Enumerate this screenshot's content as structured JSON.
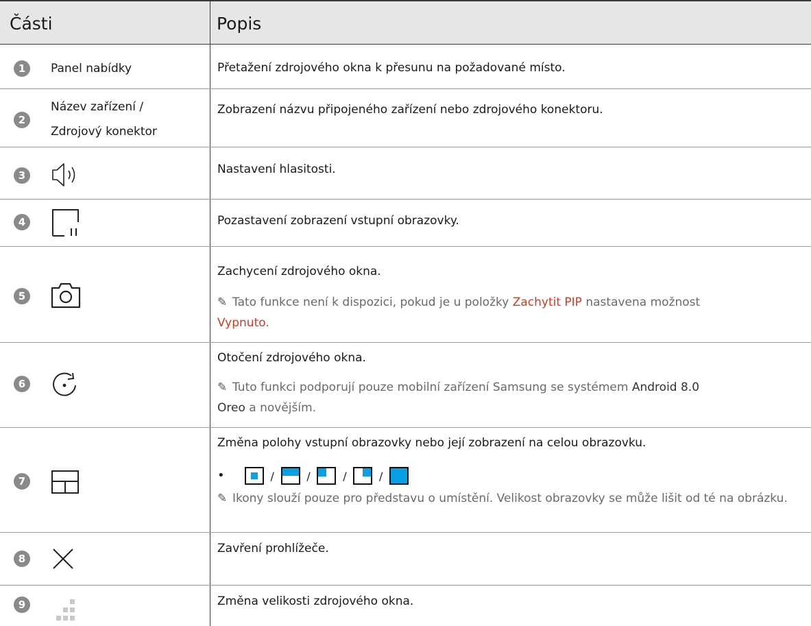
{
  "header": {
    "col_parts": "Části",
    "col_desc": "Popis"
  },
  "rows": [
    {
      "num": "1",
      "part": "Panel nabídky",
      "desc": "Přetažení zdrojového okna k přesunu na požadované místo."
    },
    {
      "num": "2",
      "part_line1": "Název zařízení /",
      "part_line2": "Zdrojový konektor",
      "desc": "Zobrazení názvu připojeného zařízení nebo zdrojového konektoru."
    },
    {
      "num": "3",
      "icon": "volume-icon",
      "desc": "Nastavení hlasitosti."
    },
    {
      "num": "4",
      "icon": "pause-screen-icon",
      "desc": "Pozastavení zobrazení vstupní obrazovky."
    },
    {
      "num": "5",
      "icon": "camera-icon",
      "desc": "Zachycení zdrojového okna.",
      "note_a": "Tato funkce není k dispozici, pokud je u položky ",
      "note_b": "Zachytit PIP",
      "note_c": " nastavena možnost",
      "note_d": "Vypnuto",
      "note_e": "."
    },
    {
      "num": "6",
      "icon": "rotate-icon",
      "desc": "Otočení zdrojového okna.",
      "note_a": "Tuto funkci podporují pouze mobilní zařízení Samsung se systémem ",
      "note_b": "Android 8.0",
      "note_c": "Oreo",
      "note_d": " a novějším."
    },
    {
      "num": "7",
      "icon": "layout-icon",
      "desc": "Změna polohy vstupní obrazovky nebo její zobrazení na celou obrazovku.",
      "bullet": "•",
      "slash": "/",
      "note": "Ikony slouží pouze pro představu o umístění. Velikost obrazovky se může lišit od té na obrázku."
    },
    {
      "num": "8",
      "icon": "close-icon",
      "desc": "Zavření prohlížeče."
    },
    {
      "num": "9",
      "icon": "resize-grip-icon",
      "desc": "Změna velikosti zdrojového okna."
    }
  ],
  "colors": {
    "accent_red": "#d9381e",
    "accent_blue": "#0aa0e6",
    "header_bg": "#e6e6e6"
  }
}
